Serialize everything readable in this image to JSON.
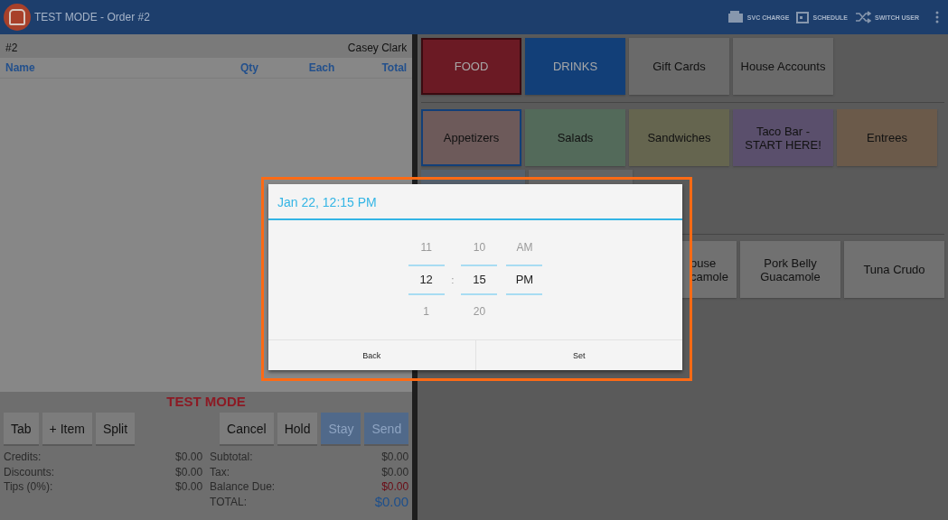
{
  "top_bar": {
    "title": "TEST MODE - Order #2",
    "actions": [
      {
        "kind": "register",
        "label": "SVC CHARGE"
      },
      {
        "kind": "calendar",
        "label": "SCHEDULE"
      },
      {
        "kind": "shuffle",
        "label": "SWITCH USER"
      }
    ]
  },
  "order": {
    "number": "#2",
    "customer": "Casey Clark",
    "columns": [
      "Name",
      "Qty",
      "Each",
      "Total"
    ],
    "mode_banner": "TEST MODE",
    "left_buttons": [
      {
        "label": "Tab",
        "disabled": false
      },
      {
        "label": "+ Item",
        "disabled": false
      },
      {
        "label": "Split",
        "disabled": false
      }
    ],
    "right_buttons": [
      {
        "label": "Cancel",
        "disabled": false
      },
      {
        "label": "Hold",
        "disabled": false
      },
      {
        "label": "Stay",
        "disabled": true
      },
      {
        "label": "Send",
        "disabled": true
      }
    ],
    "left_totals": [
      {
        "label": "Credits:",
        "value": "$0.00"
      },
      {
        "label": "Discounts:",
        "value": "$0.00"
      },
      {
        "label": "Tips (0%):",
        "value": "$0.00"
      }
    ],
    "right_totals": [
      {
        "kind": "plain",
        "label": "Subtotal:",
        "value": "$0.00"
      },
      {
        "kind": "plain",
        "label": "Tax:",
        "value": "$0.00"
      },
      {
        "kind": "due",
        "label": "Balance Due:",
        "value": "$0.00"
      },
      {
        "kind": "total",
        "label": "TOTAL:",
        "value": "$0.00"
      }
    ]
  },
  "categories": [
    {
      "label": "FOOD",
      "color": "#6b1a24",
      "selected": true
    },
    {
      "label": "DRINKS",
      "color": "#123f78",
      "selected": false
    },
    {
      "label": "Gift Cards",
      "color": "#6a6a6a",
      "selected": false
    },
    {
      "label": "House Accounts",
      "color": "#6a6a6a",
      "selected": false
    }
  ],
  "groups": [
    {
      "label": "Appetizers",
      "color": "#6d5a5a",
      "selected": true
    },
    {
      "label": "Salads",
      "color": "#536a5a",
      "selected": false
    },
    {
      "label": "Sandwiches",
      "color": "#65654f",
      "selected": false
    },
    {
      "label": "Taco Bar -\nSTART HERE!",
      "color": "#5a4f6c",
      "selected": false
    },
    {
      "label": "Entrees",
      "color": "#6b5a4a",
      "selected": false
    }
  ],
  "items": [
    {
      "label": "ouse\ncamole",
      "covered": true
    },
    {
      "label": "Pork Belly\nGuacamole",
      "covered": false
    },
    {
      "label": "Tuna Crudo",
      "covered": false
    }
  ],
  "dialog": {
    "title": "Jan 22, 12:15 PM",
    "separator": ":",
    "columns": [
      {
        "kind": "hour",
        "above": "11",
        "value": "12",
        "below": "1"
      },
      {
        "kind": "minute",
        "above": "10",
        "value": "15",
        "below": "20"
      },
      {
        "kind": "period",
        "above": "AM",
        "value": "PM"
      }
    ],
    "buttons": [
      "Back",
      "Set"
    ]
  }
}
